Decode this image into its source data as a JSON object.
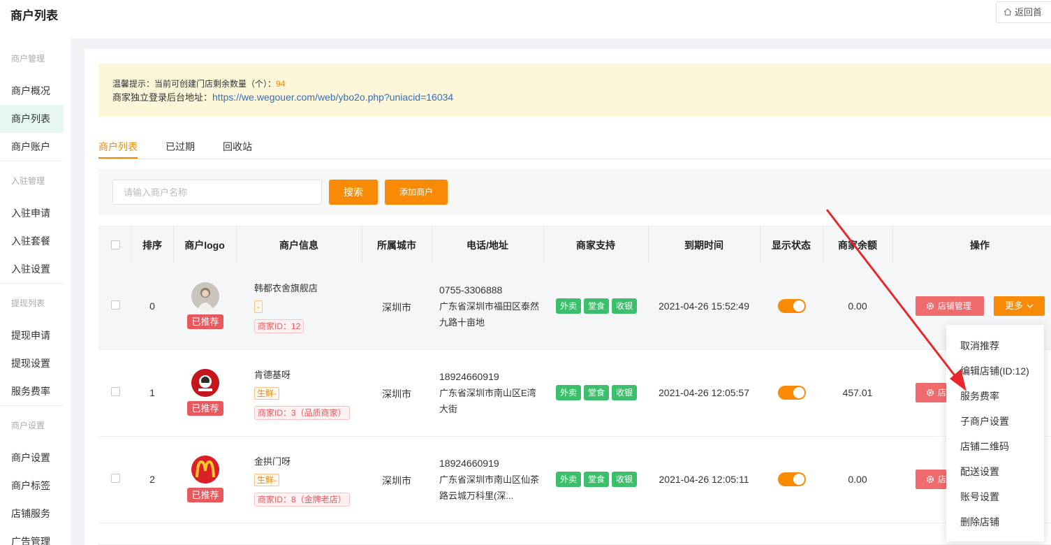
{
  "header": {
    "title": "商户列表",
    "back_label": "返回首"
  },
  "sidebar": {
    "groups": [
      {
        "label": "商户管理",
        "items": [
          {
            "label": "商户概况"
          },
          {
            "label": "商户列表"
          },
          {
            "label": "商户账户"
          }
        ]
      },
      {
        "label": "入驻管理",
        "items": [
          {
            "label": "入驻申请"
          },
          {
            "label": "入驻套餐"
          },
          {
            "label": "入驻设置"
          }
        ]
      },
      {
        "label": "提现列表",
        "items": [
          {
            "label": "提现申请"
          },
          {
            "label": "提现设置"
          },
          {
            "label": "服务费率"
          }
        ]
      },
      {
        "label": "商户设置",
        "items": [
          {
            "label": "商户设置"
          },
          {
            "label": "商户标签"
          },
          {
            "label": "店铺服务"
          },
          {
            "label": "广告管理"
          }
        ]
      }
    ]
  },
  "notice": {
    "line1_prefix": "温馨提示：当前可创建门店剩余数量（个）：",
    "line1_value": "94",
    "line2_prefix": "商家独立登录后台地址：",
    "line2_url": "https://we.wegouer.com/web/ybo2o.php?uniacid=16034"
  },
  "tabs": [
    {
      "label": "商户列表"
    },
    {
      "label": "已过期"
    },
    {
      "label": "回收站"
    }
  ],
  "search": {
    "placeholder": "请输入商户名称",
    "search_label": "搜索",
    "add_label": "添加商户"
  },
  "table": {
    "headers": [
      "排序",
      "商户logo",
      "商户信息",
      "所属城市",
      "电话/地址",
      "商家支持",
      "到期时间",
      "显示状态",
      "商家余额",
      "操作"
    ],
    "rows": [
      {
        "sort": "0",
        "recommend": "已推荐",
        "name": "韩都衣舍旗舰店",
        "category": "-",
        "merchant_id": "商家ID：12",
        "city": "深圳市",
        "phone": "0755-3306888",
        "address": "广东省深圳市福田区泰然九路十亩地",
        "support": [
          "外卖",
          "堂食",
          "收银"
        ],
        "expire": "2021-04-26 15:52:49",
        "display_on": true,
        "balance": "0.00",
        "manage_label": "店铺管理",
        "more_label": "更多"
      },
      {
        "sort": "1",
        "recommend": "已推荐",
        "name": "肯德基呀",
        "category": "生鲜-",
        "merchant_id": "商家ID：3（品质商家）",
        "city": "深圳市",
        "phone": "18924660919",
        "address": "广东省深圳市南山区E湾大街",
        "support": [
          "外卖",
          "堂食",
          "收银"
        ],
        "expire": "2021-04-26 12:05:57",
        "display_on": true,
        "balance": "457.01",
        "manage_label": "店"
      },
      {
        "sort": "2",
        "recommend": "已推荐",
        "name": "金拱门呀",
        "category": "生鲜-",
        "merchant_id": "商家ID：8（金牌老店）",
        "city": "深圳市",
        "phone": "18924660919",
        "address": "广东省深圳市南山区仙茶路云城万科里(深...",
        "support": [
          "外卖",
          "堂食",
          "收银"
        ],
        "expire": "2021-04-26 12:05:11",
        "display_on": true,
        "balance": "0.00",
        "manage_label": "店"
      }
    ]
  },
  "dropdown": {
    "items": [
      "取消推荐",
      "编辑店铺(ID:12)",
      "服务费率",
      "子商户设置",
      "店铺二维码",
      "配送设置",
      "账号设置",
      "删除店铺"
    ]
  },
  "colors": {
    "accent": "#f98a05",
    "danger": "#e8585c",
    "success": "#3cbf6b",
    "link": "#2f6fc1",
    "annotation_arrow": "#e8262b"
  }
}
